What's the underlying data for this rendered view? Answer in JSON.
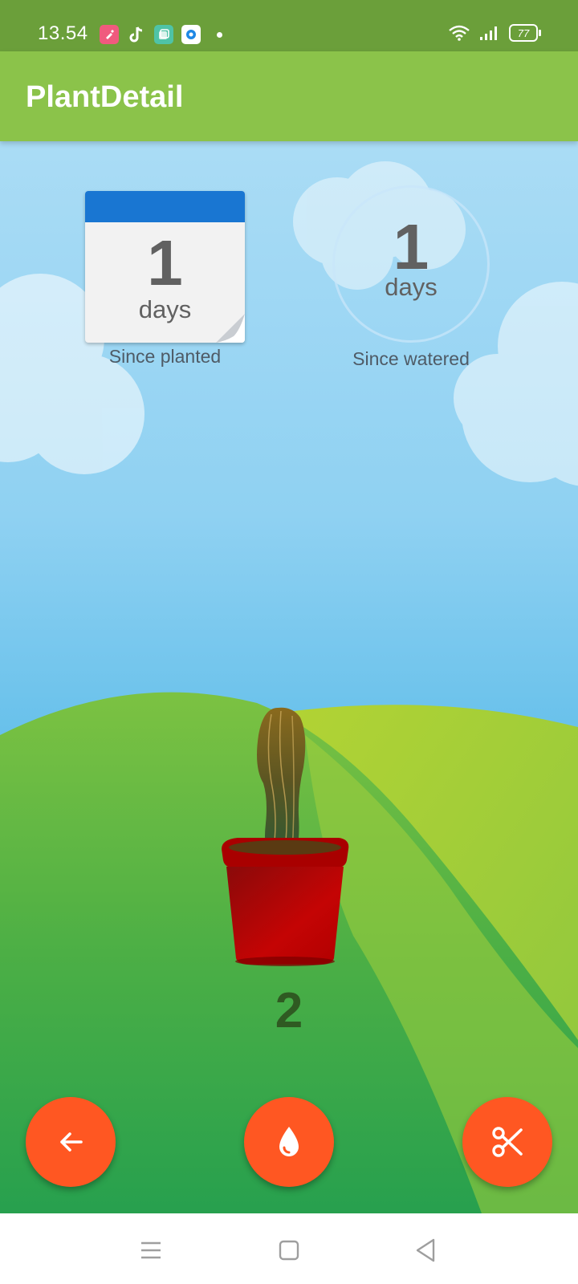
{
  "status_bar": {
    "time": "13.54",
    "battery": "77",
    "notification_icons": [
      "app-notification-icon",
      "tiktok-icon",
      "gallery-icon",
      "browser-icon"
    ]
  },
  "app_bar": {
    "title": "PlantDetail"
  },
  "planted": {
    "value": "1",
    "unit": "days",
    "label": "Since planted"
  },
  "watered": {
    "value": "1",
    "unit": "days",
    "label": "Since watered"
  },
  "plant": {
    "count": "2"
  },
  "actions": [
    "back-arrow-icon",
    "water-drop-icon",
    "scissors-icon"
  ],
  "colors": {
    "status_bar": "#6b9f3a",
    "app_bar": "#8bc34a",
    "fab": "#ff5722",
    "calendar_header": "#1976d2",
    "pot": "#c00000"
  },
  "nav": [
    "menu-icon",
    "home-icon",
    "back-icon"
  ]
}
